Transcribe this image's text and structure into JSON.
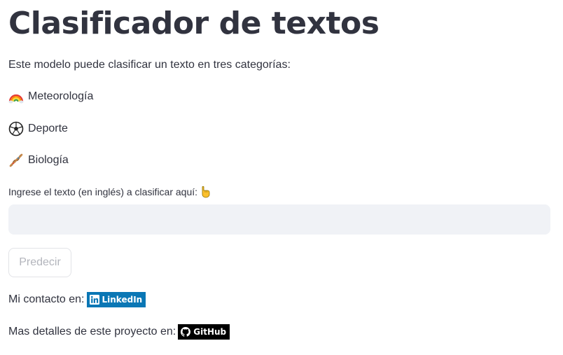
{
  "header": {
    "title": "Clasificador de textos"
  },
  "intro": {
    "text": "Este modelo puede clasificar un texto en tres categorías:"
  },
  "categories": [
    {
      "icon": "rainbow-icon",
      "label": "Meteorología"
    },
    {
      "icon": "soccer-ball-icon",
      "label": "Deporte"
    },
    {
      "icon": "dna-icon",
      "label": "Biología"
    }
  ],
  "input": {
    "label": "Ingrese el texto (en inglés) a clasificar aquí:",
    "label_icon": "pointing-down-hand-icon",
    "value": "",
    "placeholder": ""
  },
  "predict_button": {
    "label": "Predecir",
    "state": "disabled"
  },
  "contact": {
    "text": "Mi contacto en:",
    "badge_label": "LinkedIn",
    "badge_icon": "linkedin-icon",
    "badge_color": "#0a77b5"
  },
  "project": {
    "text": "Mas detalles de este proyecto en:",
    "badge_label": "GitHub",
    "badge_icon": "github-icon",
    "badge_color": "#000000"
  },
  "colors": {
    "text": "#31333f",
    "input_bg": "#f0f2f6",
    "button_border": "#e2e3e7",
    "button_text_disabled": "#b3b5bc"
  }
}
